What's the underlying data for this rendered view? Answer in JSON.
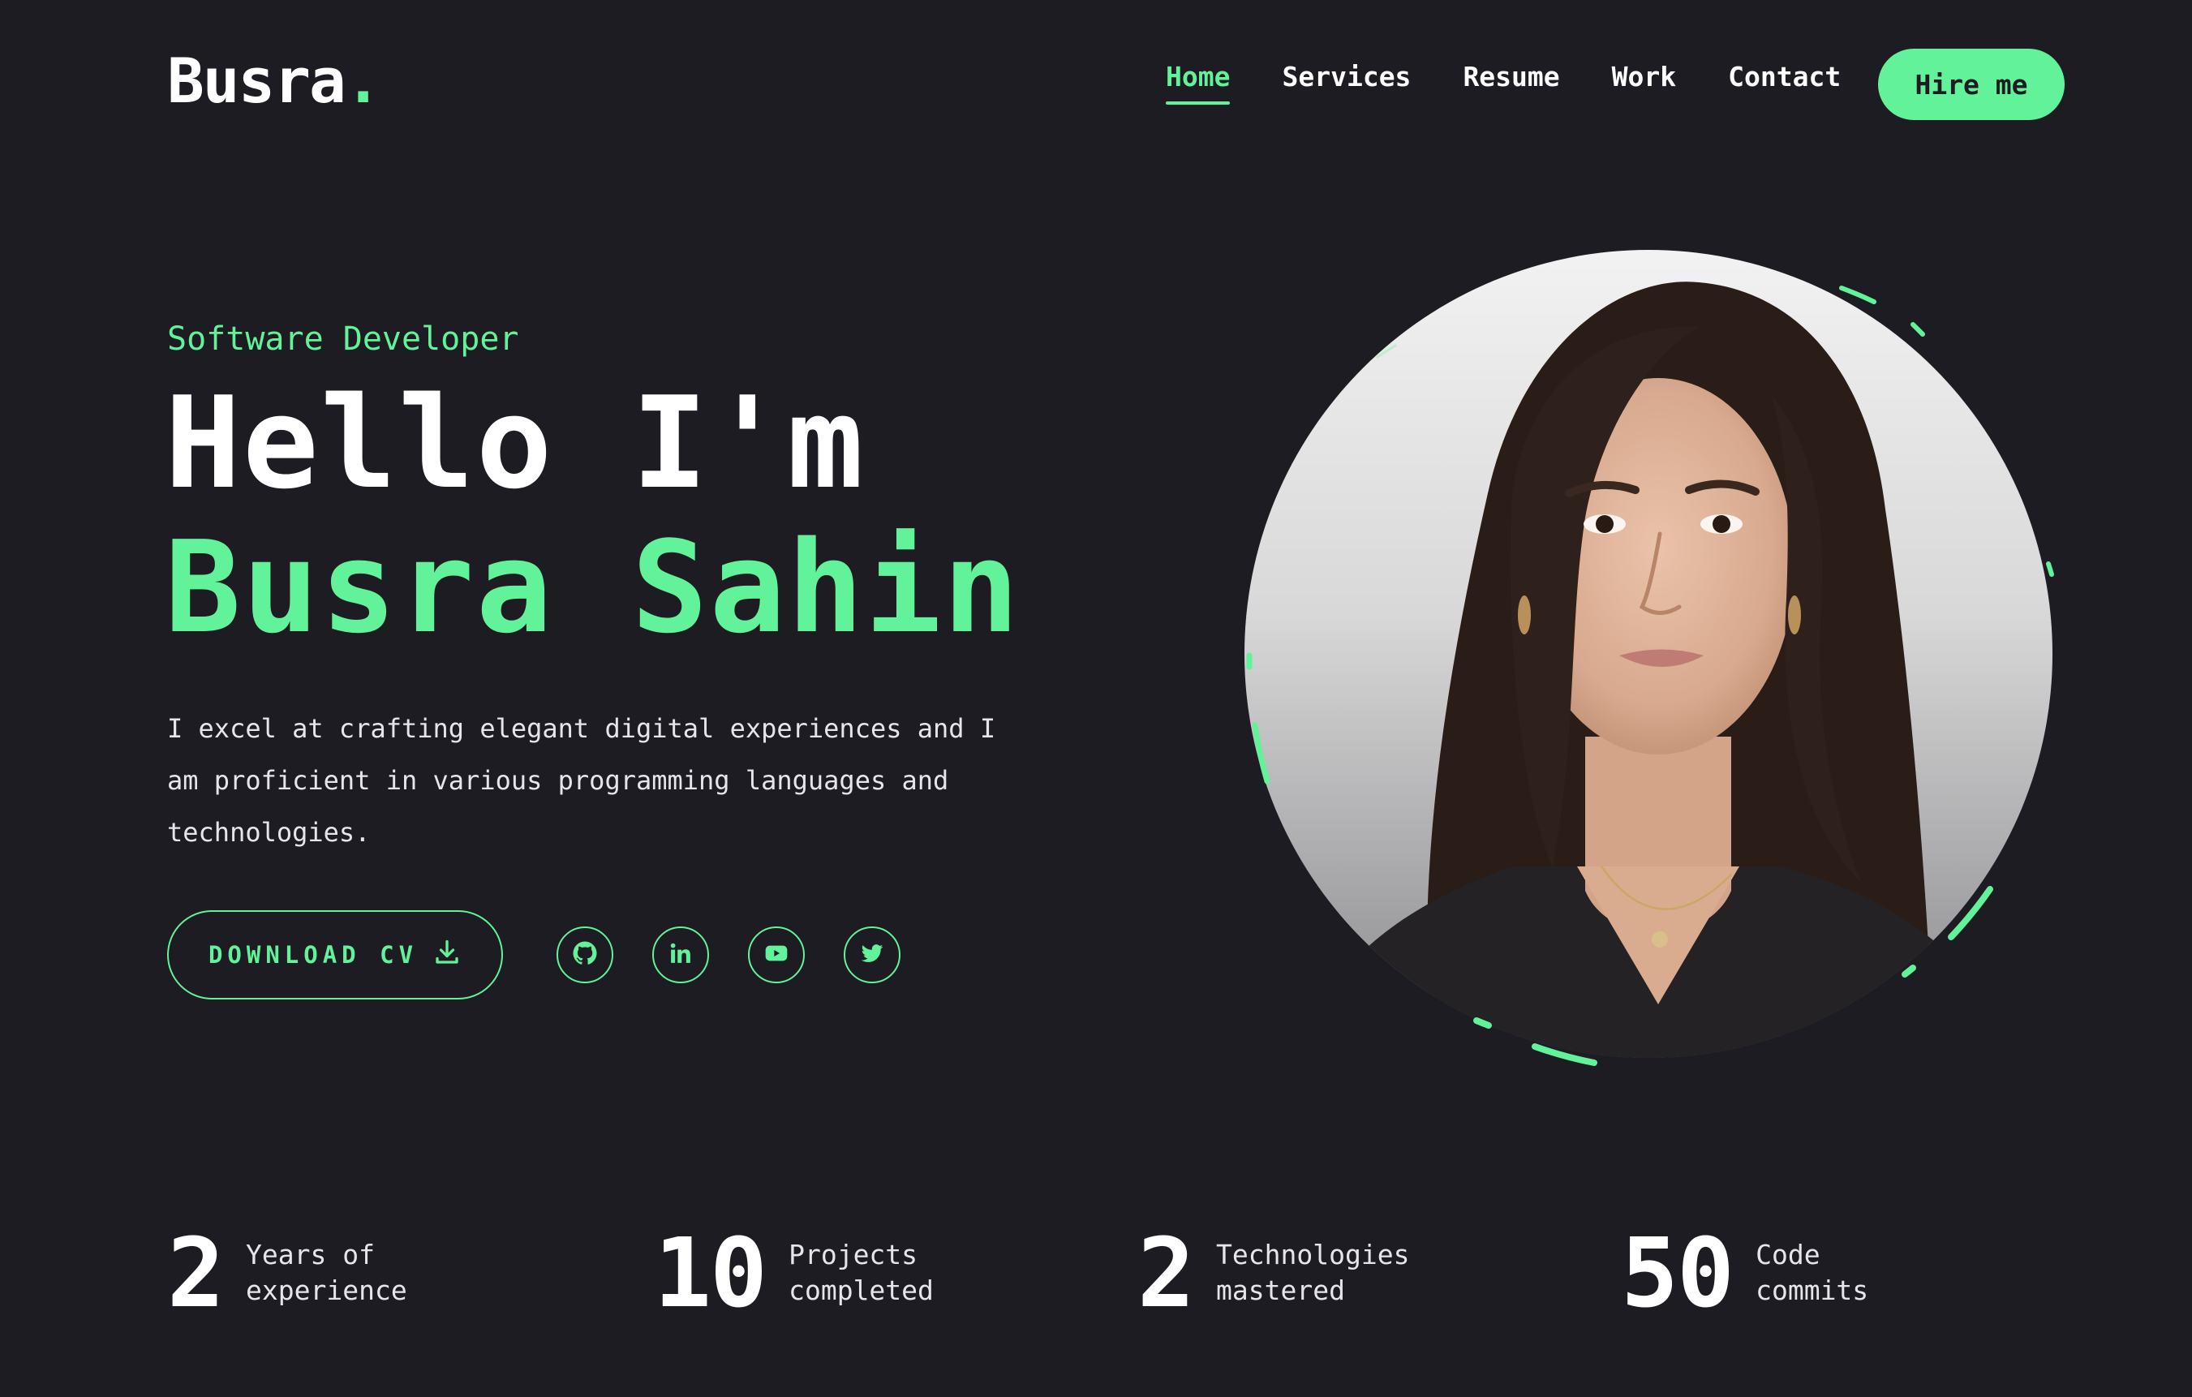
{
  "header": {
    "logo_text": "Busra",
    "logo_dot": ".",
    "nav": [
      "Home",
      "Services",
      "Resume",
      "Work",
      "Contact"
    ],
    "active_nav": "Home",
    "hire_label": "Hire me"
  },
  "hero": {
    "role": "Software Developer",
    "greeting": "Hello I'm",
    "name": "Busra Sahin",
    "description": "I excel at crafting elegant digital experiences and I am proficient in various programming languages and technologies.",
    "cv_label": "DOWNLOAD CV",
    "social_icons": [
      "github-icon",
      "linkedin-icon",
      "youtube-icon",
      "twitter-icon"
    ]
  },
  "stats": [
    {
      "value": "2",
      "label_line1": "Years of",
      "label_line2": "experience"
    },
    {
      "value": "10",
      "label_line1": "Projects",
      "label_line2": "completed"
    },
    {
      "value": "2",
      "label_line1": "Technologies",
      "label_line2": "mastered"
    },
    {
      "value": "50",
      "label_line1": "Code",
      "label_line2": "commits"
    }
  ],
  "colors": {
    "background": "#1c1c22",
    "accent": "#62f39a",
    "text": "#ffffff"
  }
}
